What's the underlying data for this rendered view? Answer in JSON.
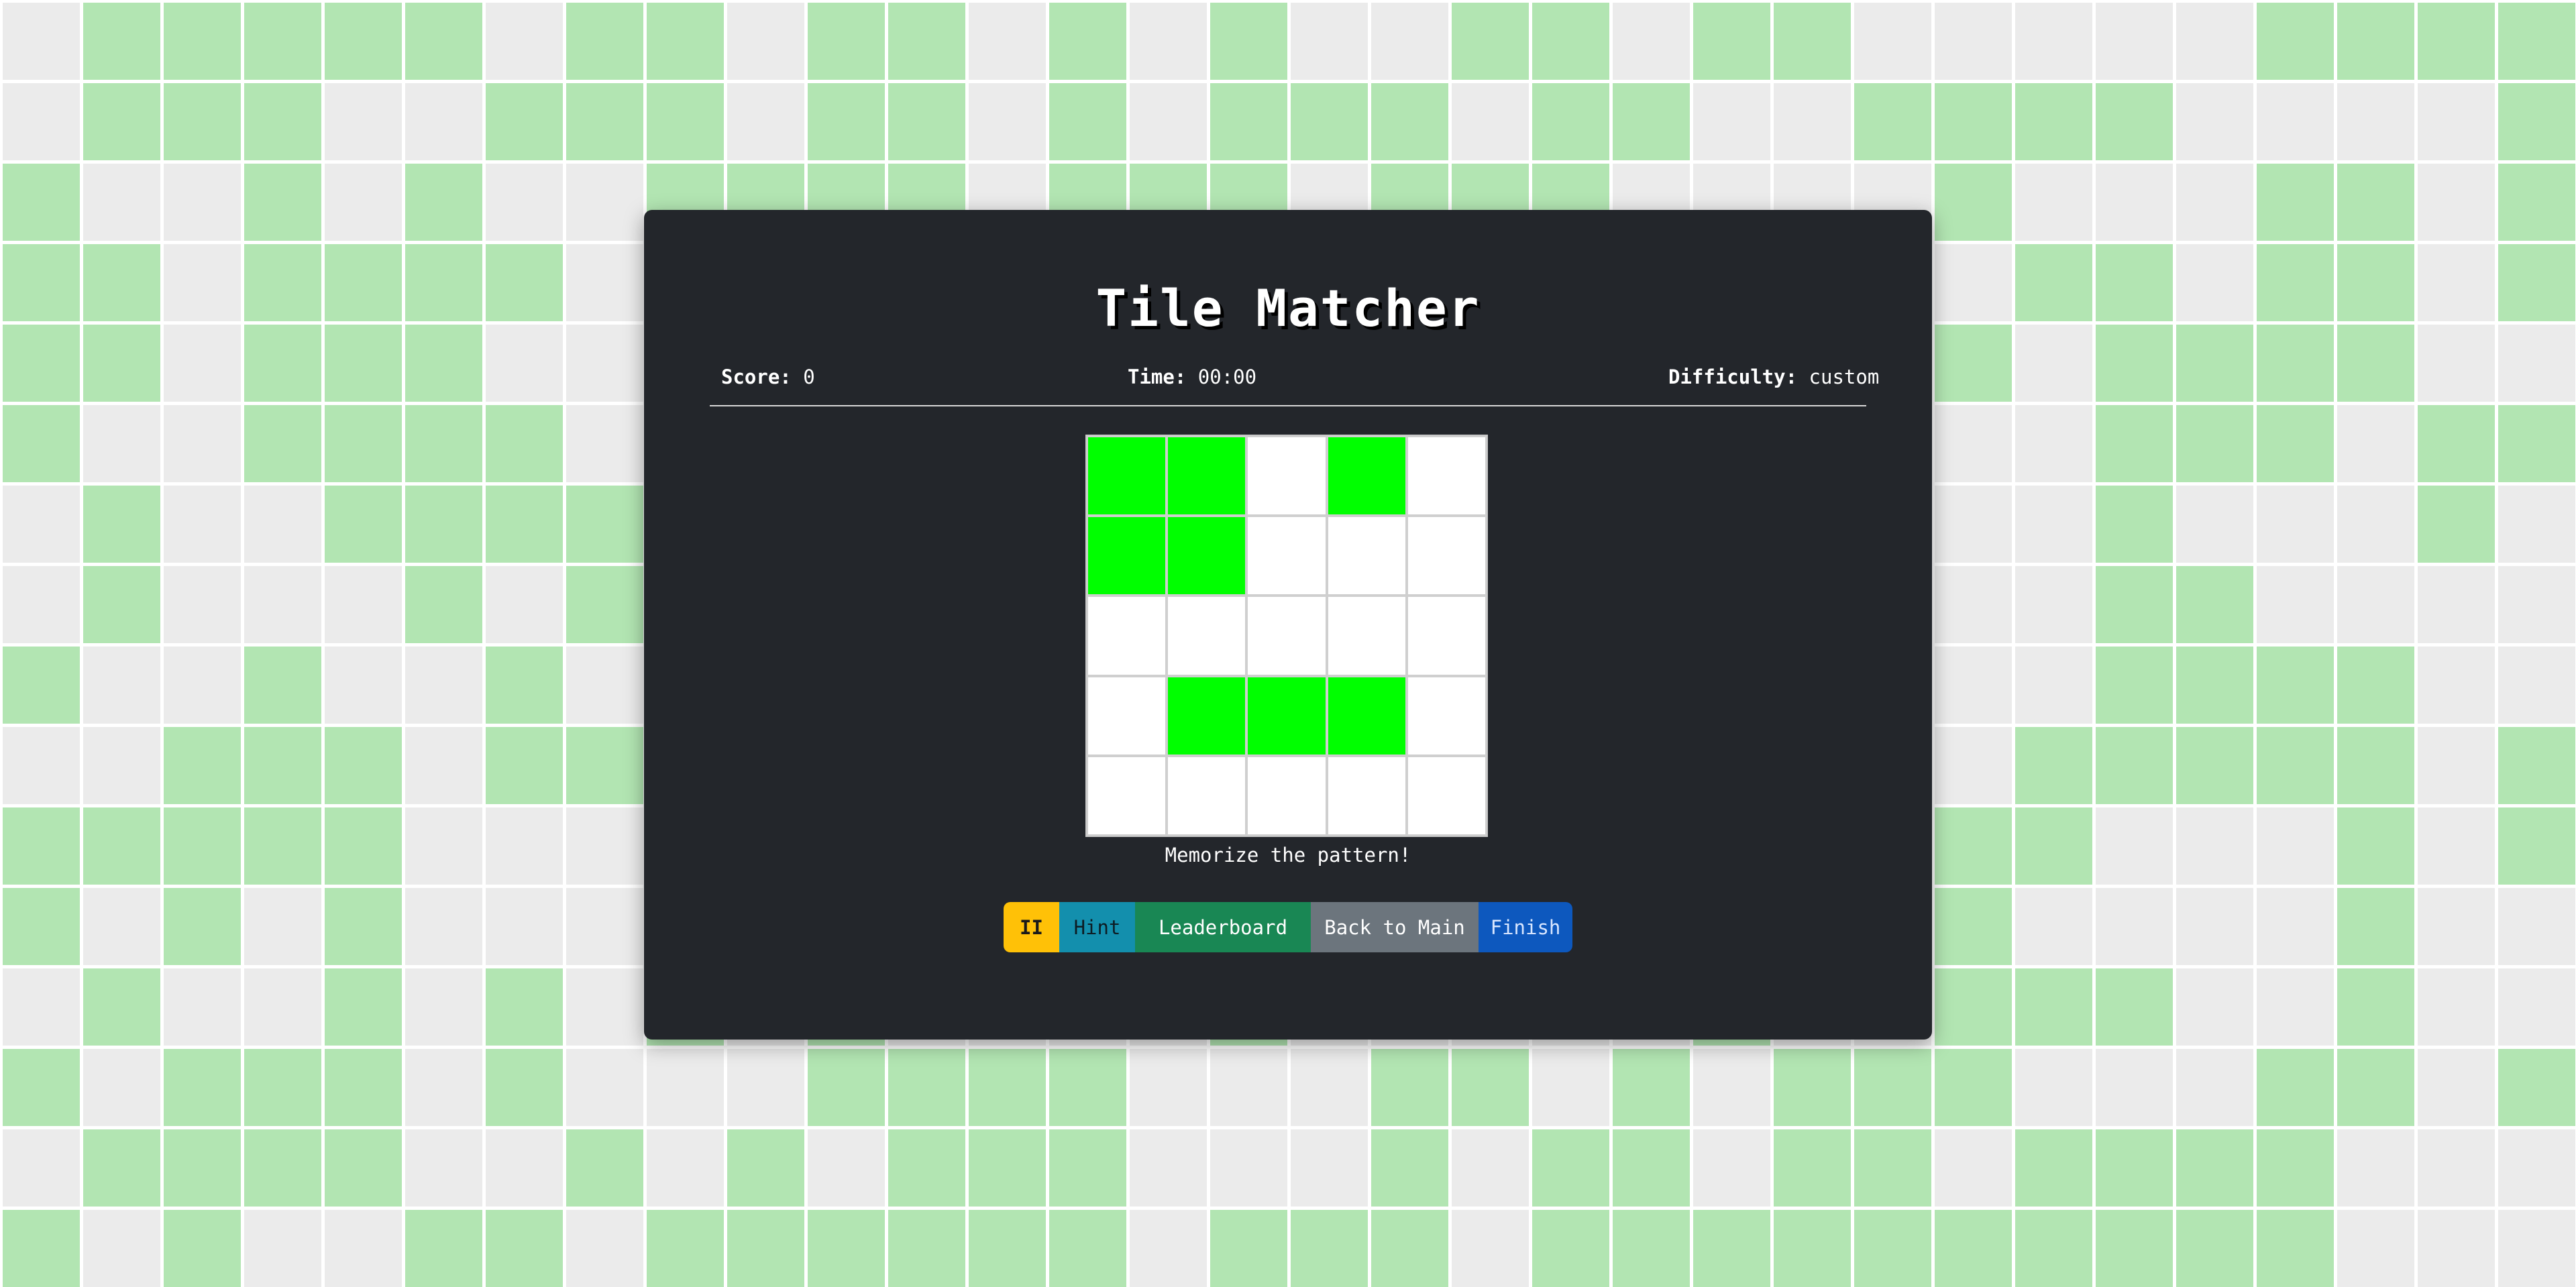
{
  "app": {
    "title": "Tile Matcher",
    "message": "Memorize the pattern!"
  },
  "stats": {
    "score_label": "Score:",
    "score_value": "0",
    "time_label": "Time:",
    "time_value": "00:00",
    "difficulty_label": "Difficulty:",
    "difficulty_value": "custom"
  },
  "board": {
    "rows": 5,
    "cols": 5,
    "pattern": [
      [
        1,
        1,
        0,
        1,
        0
      ],
      [
        1,
        1,
        0,
        0,
        0
      ],
      [
        0,
        0,
        0,
        0,
        0
      ],
      [
        0,
        1,
        1,
        1,
        0
      ],
      [
        0,
        0,
        0,
        0,
        0
      ]
    ]
  },
  "controls": {
    "pause_label": "II",
    "hint_label": "Hint",
    "leaderboard_label": "Leaderboard",
    "back_label": "Back to Main",
    "finish_label": "Finish"
  },
  "colors": {
    "panel": "#23262b",
    "tile_active": "#00ff00",
    "background_tile_on": "#b2e5b2",
    "background_tile_off": "#ebebeb",
    "pause": "#ffc107",
    "hint": "#138fad",
    "leaderboard": "#198754",
    "back": "#6c757d",
    "finish": "#0d58be"
  },
  "background": {
    "cols": 32,
    "rows": 16,
    "pattern": [
      "01111101101101010011011000001111",
      "01110011101101011101100111100001",
      "10010100111101110111000010001101",
      "11011110111011001110000001101101",
      "11011100111101100111111010111100",
      "10011110111101111100110100111011",
      "01001111000000000100010000100010",
      "01000101010000100000000000110000",
      "10010010100010101000000000111100",
      "00111011100000001100011101111101",
      "11111000101000000001000111000101",
      "10101000101000000000010010000100",
      "01001010101000010000010011100100",
      "10111010001111000110101110001101",
      "01111001010111000101101101111000",
      "10100110111111011101111111111000"
    ]
  }
}
